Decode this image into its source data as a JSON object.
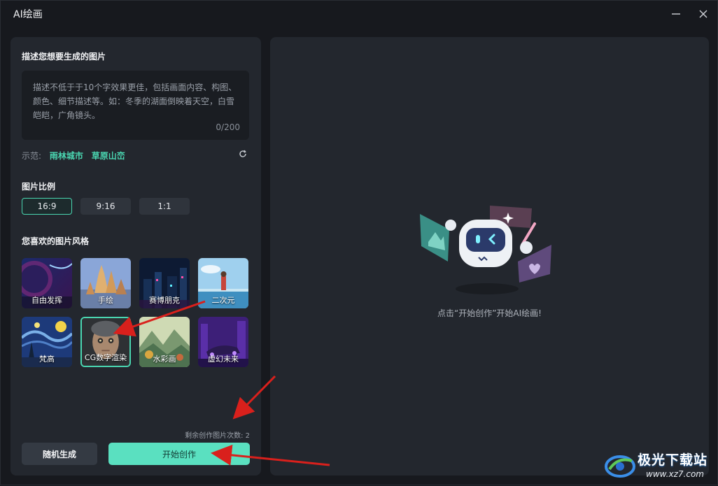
{
  "window": {
    "title": "AI绘画",
    "minimize_icon": "minimize-icon",
    "close_icon": "close-icon"
  },
  "prompt": {
    "section_title": "描述您想要生成的图片",
    "placeholder": "描述不低于于10个字效果更佳，包括画面内容、构图、颜色、细节描述等。如：冬季的湖面倒映着天空，白雪皑皑，广角镜头。",
    "counter": "0/200"
  },
  "examples": {
    "label": "示范:",
    "items": [
      "雨林城市",
      "草原山峦"
    ],
    "refresh_icon": "refresh-icon"
  },
  "ratio": {
    "section_title": "图片比例",
    "options": [
      "16:9",
      "9:16",
      "1:1"
    ],
    "selected": "16:9"
  },
  "styles": {
    "section_title": "您喜欢的图片风格",
    "items": [
      {
        "label": "自由发挥",
        "selected": false
      },
      {
        "label": "手绘",
        "selected": false
      },
      {
        "label": "赛博朋克",
        "selected": false
      },
      {
        "label": "二次元",
        "selected": false
      },
      {
        "label": "梵高",
        "selected": false
      },
      {
        "label": "CG数字渲染",
        "selected": true
      },
      {
        "label": "水彩画",
        "selected": false
      },
      {
        "label": "虚幻未来",
        "selected": false
      }
    ]
  },
  "remaining": "剩余创作图片次数: 2",
  "buttons": {
    "random": "随机生成",
    "start": "开始创作"
  },
  "preview": {
    "empty_text": "点击“开始创作”开始AI绘画!"
  },
  "watermark": {
    "name": "极光下载站",
    "url": "www.xz7.com"
  },
  "colors": {
    "accent": "#4ad6b1",
    "start_button": "#5ae0c0",
    "panel": "#23272e",
    "annotation_arrow": "#d9201c"
  }
}
